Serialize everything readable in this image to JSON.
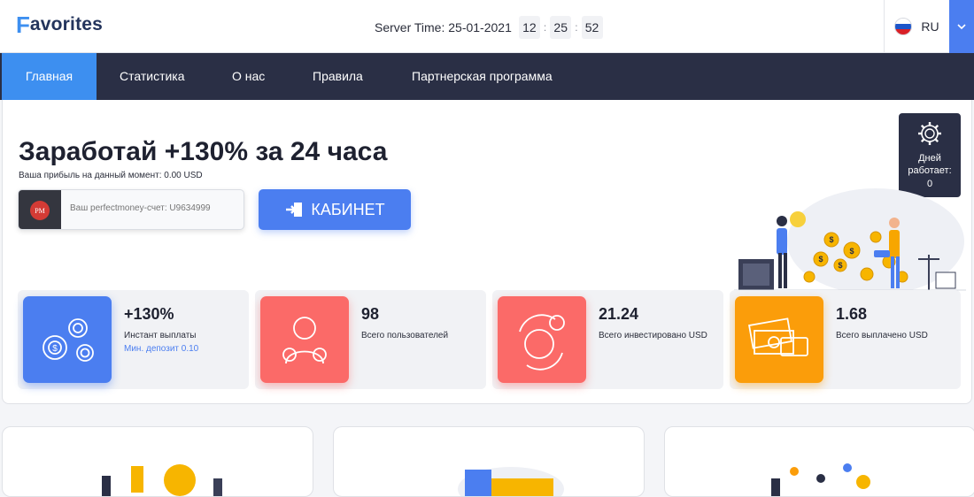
{
  "header": {
    "logo_initial": "F",
    "logo_rest": "avorites",
    "server_time_label": "Server Time: 25-01-2021",
    "time": {
      "hours": "12",
      "minutes": "25",
      "seconds": "52",
      "separator": ":"
    },
    "language": "RU",
    "colors": {
      "accent": "#4b7ef0",
      "logo": "#23345c"
    }
  },
  "nav": {
    "items": [
      {
        "label": "Главная",
        "active": true
      },
      {
        "label": "Статистика",
        "active": false
      },
      {
        "label": "О нас",
        "active": false
      },
      {
        "label": "Правила",
        "active": false
      },
      {
        "label": "Партнерская программа",
        "active": false
      }
    ],
    "colors": {
      "bg": "#2a2f45",
      "active_bg": "#3d8ff0"
    }
  },
  "hero": {
    "title": "Заработай +130% за 24 часа",
    "profit_text": "Ваша прибыль на данный момент: 0.00 USD",
    "wallet_badge": "PM",
    "wallet_placeholder": "Ваш perfectmoney-счет: U9634999",
    "cabinet_button": "КАБИНЕТ",
    "days_label": "Дней работает:",
    "days_value": "0"
  },
  "stats": [
    {
      "value": "+130%",
      "label": "Инстант выплаты",
      "sub": "Мин. депозит 0.10",
      "icon": "gears-dollar-icon",
      "color": "#4b7ef0"
    },
    {
      "value": "98",
      "label": "Всего пользователей",
      "sub": "",
      "icon": "user-money-icon",
      "color": "#fb6a68"
    },
    {
      "value": "21.24",
      "label": "Всего инвестировано USD",
      "sub": "",
      "icon": "globe-exchange-icon",
      "color": "#fb6a68"
    },
    {
      "value": "1.68",
      "label": "Всего выплачено USD",
      "sub": "",
      "icon": "banknotes-card-icon",
      "color": "#fb9d0a"
    }
  ]
}
